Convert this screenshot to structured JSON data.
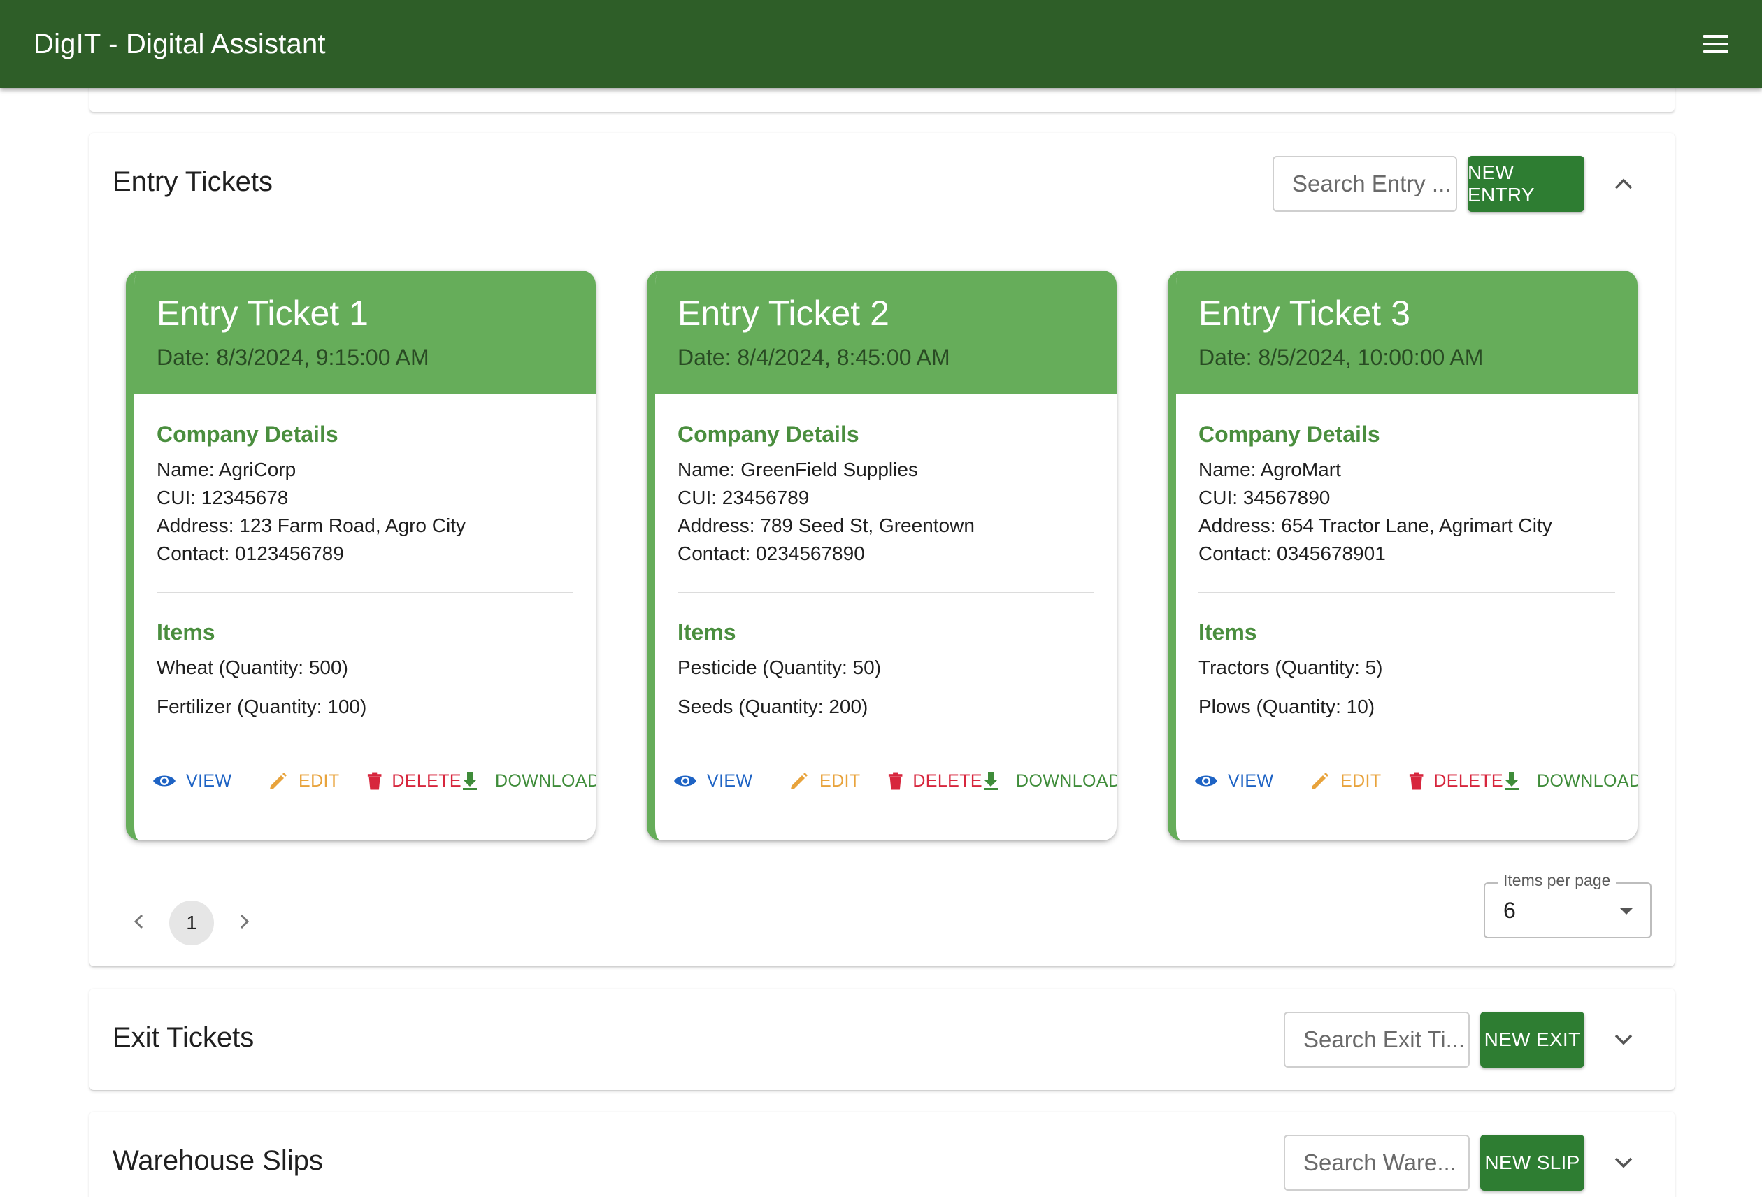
{
  "app": {
    "title": "DigIT - Digital Assistant"
  },
  "entry": {
    "title": "Entry Tickets",
    "search_placeholder": "Search Entry ...",
    "new_label": "NEW ENTRY",
    "tickets": [
      {
        "title": "Entry Ticket 1",
        "date": "Date: 8/3/2024, 9:15:00 AM",
        "company_heading": "Company Details",
        "name": "Name: AgriCorp",
        "cui": "CUI: 12345678",
        "address": "Address: 123 Farm Road, Agro City",
        "contact": "Contact: 0123456789",
        "items_heading": "Items",
        "items": [
          "Wheat (Quantity: 500)",
          "Fertilizer (Quantity: 100)"
        ]
      },
      {
        "title": "Entry Ticket 2",
        "date": "Date: 8/4/2024, 8:45:00 AM",
        "company_heading": "Company Details",
        "name": "Name: GreenField Supplies",
        "cui": "CUI: 23456789",
        "address": "Address: 789 Seed St, Greentown",
        "contact": "Contact: 0234567890",
        "items_heading": "Items",
        "items": [
          "Pesticide (Quantity: 50)",
          "Seeds (Quantity: 200)"
        ]
      },
      {
        "title": "Entry Ticket 3",
        "date": "Date: 8/5/2024, 10:00:00 AM",
        "company_heading": "Company Details",
        "name": "Name: AgroMart",
        "cui": "CUI: 34567890",
        "address": "Address: 654 Tractor Lane, Agrimart City",
        "contact": "Contact: 0345678901",
        "items_heading": "Items",
        "items": [
          "Tractors (Quantity: 5)",
          "Plows (Quantity: 10)"
        ]
      }
    ],
    "actions": {
      "view": "VIEW",
      "edit": "EDIT",
      "delete": "DELETE",
      "download": "DOWNLOAD"
    },
    "pagination": {
      "current_page": "1",
      "items_per_page_label": "Items per page",
      "items_per_page": "6"
    }
  },
  "exit": {
    "title": "Exit Tickets",
    "search_placeholder": "Search Exit Ti...",
    "new_label": "NEW EXIT"
  },
  "warehouse": {
    "title": "Warehouse Slips",
    "search_placeholder": "Search Ware...",
    "new_label": "NEW SLIP"
  },
  "colors": {
    "appbar": "#2e5e28",
    "primary_button": "#2e7d32",
    "card_header": "#66ad5a",
    "section_heading": "#4a8e3e",
    "view": "#1e63c4",
    "edit": "#e8a33c",
    "delete": "#d7263d",
    "download": "#3f8c3a"
  },
  "icons": {
    "menu": "menu-icon",
    "collapse": "chevron-up-icon",
    "expand": "chevron-down-icon",
    "view": "eye-icon",
    "edit": "pencil-icon",
    "delete": "trash-icon",
    "download": "download-icon",
    "prev": "chevron-left-icon",
    "next": "chevron-right-icon"
  }
}
